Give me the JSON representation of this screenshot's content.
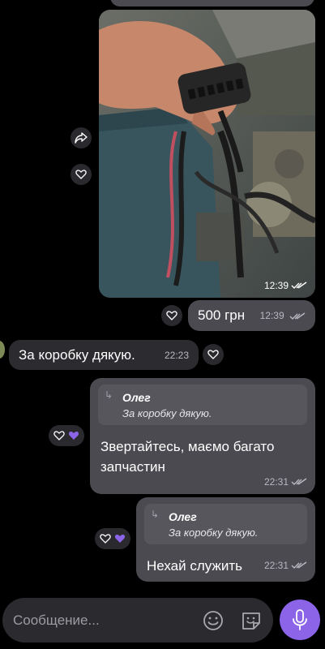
{
  "messages": {
    "photo": {
      "time": "12:39"
    },
    "price": {
      "text": "500 грн",
      "time": "12:39"
    },
    "incoming": {
      "text": "За коробку дякую.",
      "time": "22:23"
    },
    "reply1": {
      "quote_name": "Олег",
      "quote_text": "За коробку дякую.",
      "line1": "Звертайтесь, маємо багато",
      "line2": "запчастин",
      "time": "22:31"
    },
    "reply2": {
      "quote_name": "Олег",
      "quote_text": "За коробку дякую.",
      "text": "Нехай служить",
      "time": "22:31"
    }
  },
  "composer": {
    "placeholder": "Сообщение..."
  },
  "colors": {
    "accent": "#8c64e8",
    "bubble_out": "#4a4a50",
    "bubble_in": "#2c2c30"
  }
}
